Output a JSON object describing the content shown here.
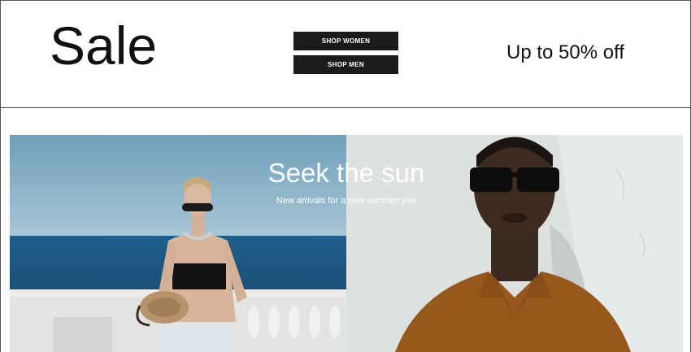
{
  "sale": {
    "title": "Sale",
    "buttons": [
      {
        "label": "SHOP WOMEN"
      },
      {
        "label": "SHOP MEN"
      }
    ],
    "offer": "Up to 50% off"
  },
  "hero": {
    "heading": "Seek the sun",
    "subheading": "New arrivals for a new summer you"
  },
  "colors": {
    "button_bg": "#1b1b1b",
    "sky": "#7fa9c0",
    "sea": "#1d5a85",
    "shirt": "#9a5a1c",
    "wall": "#dfe3e2"
  }
}
